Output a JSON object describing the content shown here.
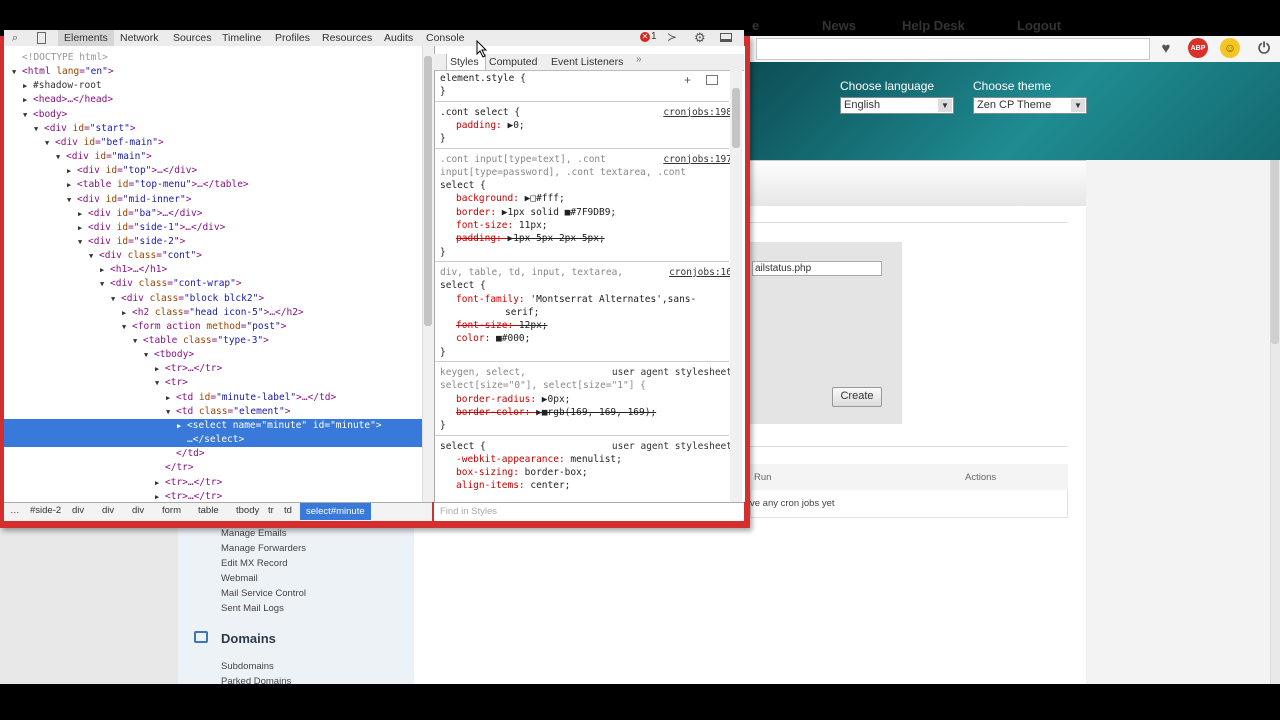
{
  "chrome": {
    "icons": [
      "heart-icon",
      "adblock-icon",
      "smiley-icon",
      "power-icon"
    ],
    "adblock_label": "ABP"
  },
  "hero": {
    "language_label": "Choose language",
    "language_value": "English",
    "theme_label": "Choose theme",
    "theme_value": "Zen CP Theme"
  },
  "nav": {
    "items": [
      "e",
      "News",
      "Help Desk",
      "Logout"
    ]
  },
  "cron": {
    "command_value": "ailstatus.php",
    "create_label": "Create",
    "table_head_run": "Run",
    "table_head_actions": "Actions",
    "empty_text": "ve any cron jobs yet"
  },
  "sidebar": {
    "links_top": [
      "Manage Emails",
      "Manage Forwarders",
      "Edit MX Record",
      "Webmail",
      "Mail Service Control",
      "Sent Mail Logs"
    ],
    "domains_title": "Domains",
    "links_domains": [
      "Subdomains",
      "Parked Domains"
    ]
  },
  "devtools": {
    "tabs": [
      "Elements",
      "Network",
      "Sources",
      "Timeline",
      "Profiles",
      "Resources",
      "Audits",
      "Console"
    ],
    "error_count": "1",
    "dom_lines": [
      {
        "i": 0,
        "t": "",
        "txt": "<!DOCTYPE html>",
        "cls": "gray"
      },
      {
        "i": 0,
        "t": "▼",
        "txt": "<html lang=\"en\">"
      },
      {
        "i": 1,
        "t": "▶",
        "txt": "#shadow-root",
        "cls": "plain"
      },
      {
        "i": 1,
        "t": "▶",
        "txt": "<head>…</head>"
      },
      {
        "i": 1,
        "t": "▼",
        "txt": "<body>"
      },
      {
        "i": 2,
        "t": "▼",
        "txt": "<div id=\"start\">"
      },
      {
        "i": 3,
        "t": "▼",
        "txt": "<div id=\"bef-main\">"
      },
      {
        "i": 4,
        "t": "▼",
        "txt": "<div id=\"main\">"
      },
      {
        "i": 5,
        "t": "▶",
        "txt": "<div id=\"top\">…</div>"
      },
      {
        "i": 5,
        "t": "▶",
        "txt": "<table id=\"top-menu\">…</table>"
      },
      {
        "i": 5,
        "t": "▼",
        "txt": "<div id=\"mid-inner\">"
      },
      {
        "i": 6,
        "t": "▶",
        "txt": "<div id=\"ba\">…</div>"
      },
      {
        "i": 6,
        "t": "▶",
        "txt": "<div id=\"side-1\">…</div>"
      },
      {
        "i": 6,
        "t": "▼",
        "txt": "<div id=\"side-2\">"
      },
      {
        "i": 7,
        "t": "▼",
        "txt": "<div class=\"cont\">"
      },
      {
        "i": 8,
        "t": "▶",
        "txt": "<h1>…</h1>"
      },
      {
        "i": 8,
        "t": "▼",
        "txt": "<div class=\"cont-wrap\">"
      },
      {
        "i": 9,
        "t": "▼",
        "txt": "<div class=\"block blck2\">"
      },
      {
        "i": 10,
        "t": "▶",
        "txt": "<h2 class=\"head icon-5\">…</h2>"
      },
      {
        "i": 10,
        "t": "▼",
        "txt": "<form action method=\"post\">"
      },
      {
        "i": 11,
        "t": "▼",
        "txt": "<table class=\"type-3\">"
      },
      {
        "i": 12,
        "t": "▼",
        "txt": "<tbody>"
      },
      {
        "i": 13,
        "t": "▶",
        "txt": "<tr>…</tr>"
      },
      {
        "i": 13,
        "t": "▼",
        "txt": "<tr>"
      },
      {
        "i": 14,
        "t": "▶",
        "txt": "<td id=\"minute-label\">…</td>"
      },
      {
        "i": 14,
        "t": "▼",
        "txt": "<td class=\"element\">"
      },
      {
        "i": 15,
        "t": "▶",
        "txt": "<select name=\"minute\" id=\"minute\">",
        "sel": true
      },
      {
        "i": 15,
        "t": "",
        "txt": "…</select>",
        "sel": true
      },
      {
        "i": 14,
        "t": "",
        "txt": "</td>"
      },
      {
        "i": 13,
        "t": "",
        "txt": "</tr>"
      },
      {
        "i": 13,
        "t": "▶",
        "txt": "<tr>…</tr>"
      },
      {
        "i": 13,
        "t": "▶",
        "txt": "<tr>…</tr>"
      }
    ],
    "crumbs": [
      "…",
      "#side-2",
      "div",
      "div",
      "div",
      "form",
      "table",
      "tbody",
      "tr",
      "td",
      "select#minute"
    ],
    "style_tabs": [
      "Styles",
      "Computed",
      "Event Listeners"
    ],
    "find_placeholder": "Find in Styles",
    "style_lines": [
      {
        "k": "sel",
        "txt": "element.style {"
      },
      {
        "k": "close",
        "txt": "}"
      },
      {
        "k": "sep"
      },
      {
        "k": "sel",
        "txt": ".cont select {",
        "src": "cronjobs:198"
      },
      {
        "k": "prop",
        "p": "padding",
        "v": "▶0;"
      },
      {
        "k": "close",
        "txt": "}"
      },
      {
        "k": "sep"
      },
      {
        "k": "selg",
        "txt": ".cont input[type=text], .cont",
        "src": "cronjobs:197"
      },
      {
        "k": "selg",
        "txt": "input[type=password], .cont textarea, .cont"
      },
      {
        "k": "sel",
        "txt": "select {"
      },
      {
        "k": "prop",
        "p": "background",
        "v": "▶□#fff;"
      },
      {
        "k": "prop",
        "p": "border",
        "v": "▶1px solid ■#7F9DB9;"
      },
      {
        "k": "prop",
        "p": "font-size",
        "v": "11px;"
      },
      {
        "k": "prop",
        "p": "padding",
        "v": "▶1px 5px 2px 5px;",
        "strike": true
      },
      {
        "k": "close",
        "txt": "}"
      },
      {
        "k": "sep"
      },
      {
        "k": "selg",
        "txt": "div, table, td, input, textarea,",
        "src": "cronjobs:16"
      },
      {
        "k": "sel",
        "txt": "select {"
      },
      {
        "k": "prop",
        "p": "font-family",
        "v": "'Montserrat Alternates',sans-"
      },
      {
        "k": "cont",
        "txt": "serif;"
      },
      {
        "k": "prop",
        "p": "font-size",
        "v": "12px;",
        "strike": true
      },
      {
        "k": "prop",
        "p": "color",
        "v": "■#000;"
      },
      {
        "k": "close",
        "txt": "}"
      },
      {
        "k": "sep"
      },
      {
        "k": "selg",
        "txt": "keygen, select,",
        "ua": "user agent stylesheet"
      },
      {
        "k": "selg",
        "txt": "select[size=\"0\"], select[size=\"1\"] {"
      },
      {
        "k": "prop",
        "p": "border-radius",
        "v": "▶0px;"
      },
      {
        "k": "prop",
        "p": "border-color",
        "v": "▶■rgb(169, 169, 169);",
        "strike": true
      },
      {
        "k": "close",
        "txt": "}"
      },
      {
        "k": "sep"
      },
      {
        "k": "sel",
        "txt": "select {",
        "ua": "user agent stylesheet"
      },
      {
        "k": "prop",
        "p": "-webkit-appearance",
        "v": "menulist;"
      },
      {
        "k": "prop",
        "p": "box-sizing",
        "v": "border-box;"
      },
      {
        "k": "prop",
        "p": "align-items",
        "v": "center;"
      }
    ]
  }
}
